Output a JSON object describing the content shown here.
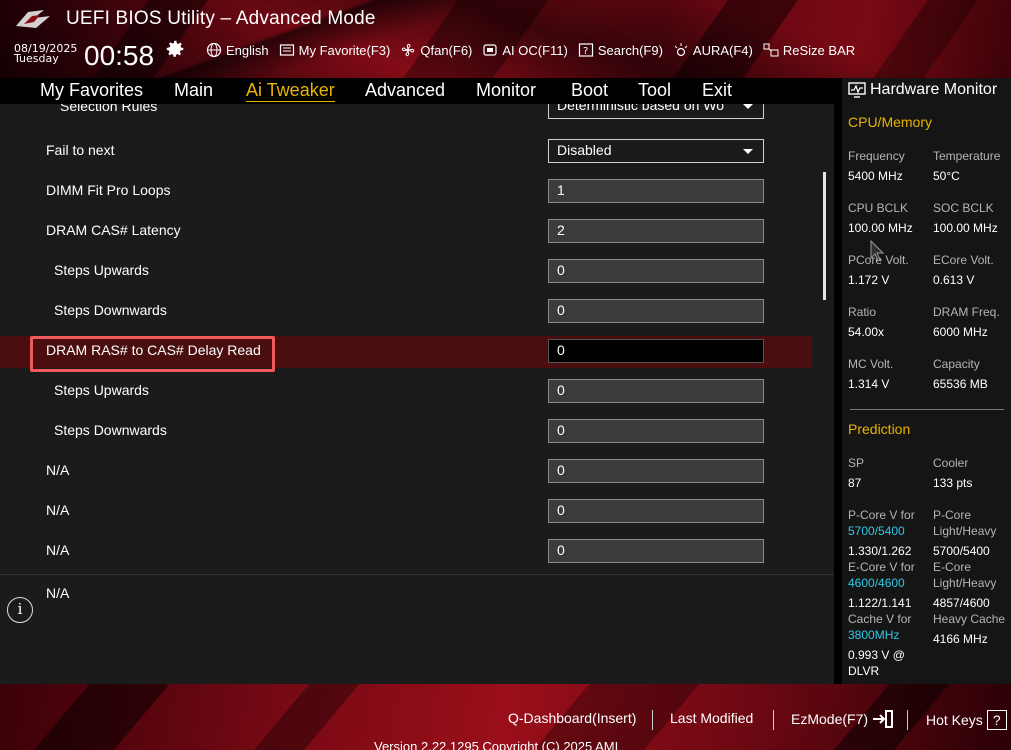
{
  "header": {
    "title": "UEFI BIOS Utility – Advanced Mode",
    "date": "08/19/2025",
    "day": "Tuesday",
    "time": "00:58",
    "toolbar": [
      {
        "label": "English",
        "icon": "globe-icon"
      },
      {
        "label": "My Favorite(F3)",
        "icon": "favorite-icon"
      },
      {
        "label": "Qfan(F6)",
        "icon": "fan-icon"
      },
      {
        "label": "AI OC(F11)",
        "icon": "ai-oc-icon"
      },
      {
        "label": "Search(F9)",
        "icon": "search-icon"
      },
      {
        "label": "AURA(F4)",
        "icon": "aura-icon"
      },
      {
        "label": "ReSize BAR",
        "icon": "resize-bar-icon"
      }
    ]
  },
  "menu": {
    "items": [
      "My Favorites",
      "Main",
      "Ai Tweaker",
      "Advanced",
      "Monitor",
      "Boot",
      "Tool",
      "Exit"
    ],
    "active": "Ai Tweaker"
  },
  "settings": {
    "partial_label": "Selection Rules",
    "partial_value": "Deterministic based on Wo",
    "rows": [
      {
        "label": "Fail to next",
        "value": "Disabled",
        "type": "dropdown"
      },
      {
        "label": "DIMM Fit Pro Loops",
        "value": "1",
        "type": "input"
      },
      {
        "label": "DRAM CAS# Latency",
        "value": "2",
        "type": "input"
      },
      {
        "label": "Steps Upwards",
        "value": "0",
        "type": "input"
      },
      {
        "label": "Steps Downwards",
        "value": "0",
        "type": "input"
      },
      {
        "label": "DRAM RAS# to CAS# Delay Read",
        "value": "0",
        "type": "input",
        "selected": true
      },
      {
        "label": "Steps Upwards",
        "value": "0",
        "type": "input"
      },
      {
        "label": "Steps Downwards",
        "value": "0",
        "type": "input"
      },
      {
        "label": "N/A",
        "value": "0",
        "type": "input"
      },
      {
        "label": "N/A",
        "value": "0",
        "type": "input"
      },
      {
        "label": "N/A",
        "value": "0",
        "type": "input"
      }
    ]
  },
  "info": {
    "text": "N/A"
  },
  "hardware_monitor": {
    "title": "Hardware Monitor",
    "cpu_memory_title": "CPU/Memory",
    "cpu": [
      {
        "k": "Frequency",
        "v": "5400 MHz"
      },
      {
        "k": "Temperature",
        "v": "50°C"
      },
      {
        "k": "CPU BCLK",
        "v": "100.00 MHz"
      },
      {
        "k": "SOC BCLK",
        "v": "100.00 MHz"
      },
      {
        "k": "PCore Volt.",
        "v": "1.172 V"
      },
      {
        "k": "ECore Volt.",
        "v": "0.613 V"
      },
      {
        "k": "Ratio",
        "v": "54.00x"
      },
      {
        "k": "DRAM Freq.",
        "v": "6000 MHz"
      },
      {
        "k": "MC Volt.",
        "v": "1.314 V"
      },
      {
        "k": "Capacity",
        "v": "65536 MB"
      }
    ],
    "prediction_title": "Prediction",
    "sp": {
      "k": "SP",
      "v": "87"
    },
    "cooler": {
      "k": "Cooler",
      "v": "133 pts"
    },
    "pcore_v_for": "P-Core V for",
    "pcore_freq": "5700/5400",
    "pcore_val": "1.330/1.262",
    "pcore_lh": "P-Core",
    "pcore_lh2": "Light/Heavy",
    "pcore_lh_val": "5700/5400",
    "ecore_v_for": "E-Core V for",
    "ecore_freq": "4600/4600",
    "ecore_val": "1.122/1.141",
    "ecore_lh": "E-Core",
    "ecore_lh2": "Light/Heavy",
    "ecore_lh_val": "4857/4600",
    "cache_v_for": "Cache V for",
    "cache_freq": "3800MHz",
    "cache_val": "0.993 V @",
    "cache_val2": "DLVR",
    "heavy_cache": "Heavy Cache",
    "heavy_cache_val": "4166 MHz"
  },
  "footer": {
    "qdash": "Q-Dashboard(Insert)",
    "last_modified": "Last Modified",
    "ezmode": "EzMode(F7)",
    "hotkeys": "Hot Keys",
    "hotkeys_icon": "?",
    "version": "Version 2.22.1295 Copyright (C) 2025 AMI"
  },
  "colors": {
    "accent": "#e8b400",
    "cyan": "#2ec8e6",
    "selected_row": "#4a0e0e",
    "highlight": "#f05a5a"
  }
}
